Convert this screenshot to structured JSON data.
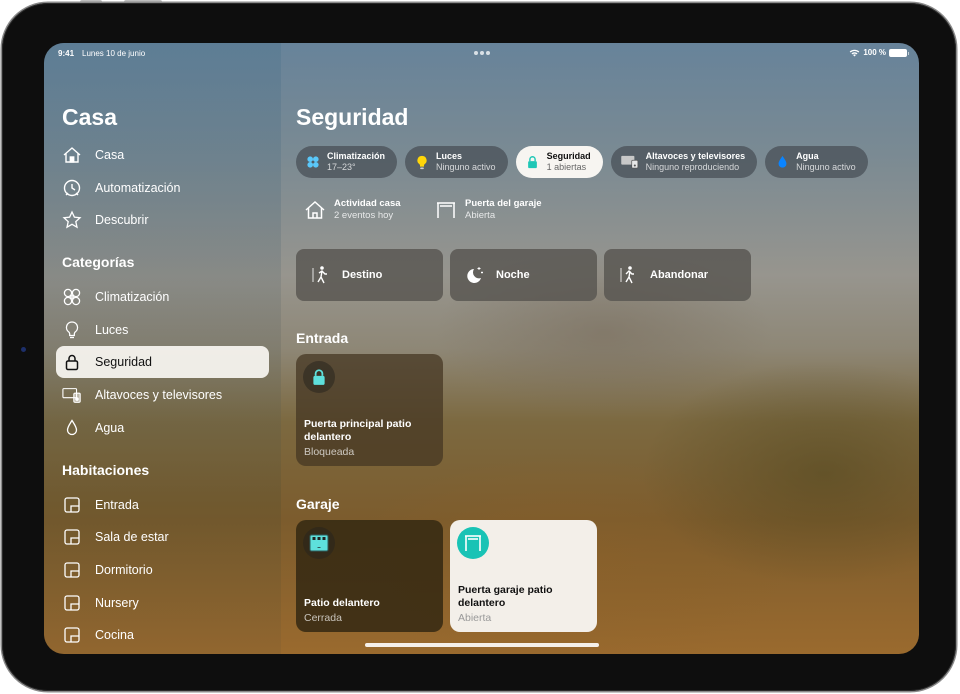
{
  "status_bar": {
    "time": "9:41",
    "date": "Lunes 10 de junio",
    "battery": "100 %",
    "wifi_icon": "wifi-icon",
    "battery_icon": "battery-icon"
  },
  "sidebar": {
    "title": "Casa",
    "nav": [
      {
        "label": "Casa",
        "icon": "house-icon"
      },
      {
        "label": "Automatización",
        "icon": "clock-icon"
      },
      {
        "label": "Descubrir",
        "icon": "star-icon"
      }
    ],
    "categories_title": "Categorías",
    "categories": [
      {
        "label": "Climatización",
        "icon": "fan-icon"
      },
      {
        "label": "Luces",
        "icon": "lightbulb-icon"
      },
      {
        "label": "Seguridad",
        "icon": "lock-icon",
        "selected": true
      },
      {
        "label": "Altavoces y televisores",
        "icon": "tv-speaker-icon"
      },
      {
        "label": "Agua",
        "icon": "drop-icon"
      }
    ],
    "rooms_title": "Habitaciones",
    "rooms": [
      {
        "label": "Entrada",
        "icon": "room-icon"
      },
      {
        "label": "Sala de estar",
        "icon": "room-icon"
      },
      {
        "label": "Dormitorio",
        "icon": "room-icon"
      },
      {
        "label": "Nursery",
        "icon": "room-icon"
      },
      {
        "label": "Cocina",
        "icon": "room-icon"
      }
    ]
  },
  "main": {
    "title": "Seguridad",
    "chips": [
      {
        "name": "Climatización",
        "sub": "17–23°",
        "icon": "fan-icon",
        "color": "#5ac8fa"
      },
      {
        "name": "Luces",
        "sub": "Ninguno activo",
        "icon": "lightbulb-icon",
        "color": "#ffd60a"
      },
      {
        "name": "Seguridad",
        "sub": "1 abiertas",
        "icon": "lock-icon",
        "color": "#1fc7b6",
        "selected": true
      },
      {
        "name": "Altavoces y televisores",
        "sub": "Ninguno reproduciendo",
        "icon": "tv-speaker-icon",
        "color": "#d0d0d0"
      },
      {
        "name": "Agua",
        "sub": "Ninguno activo",
        "icon": "drop-icon",
        "color": "#0a84ff"
      }
    ],
    "summary": [
      {
        "name": "Actividad casa",
        "sub": "2 eventos hoy",
        "icon": "house-icon"
      },
      {
        "name": "Puerta del garaje",
        "sub": "Abierta",
        "icon": "garage-door-icon"
      }
    ],
    "scenes": [
      {
        "label": "Destino",
        "icon": "person-arrive-icon"
      },
      {
        "label": "Noche",
        "icon": "moon-icon"
      },
      {
        "label": "Abandonar",
        "icon": "person-leave-icon"
      }
    ],
    "groups": [
      {
        "title": "Entrada",
        "tiles": [
          {
            "name": "Puerta principal patio delantero",
            "status": "Bloqueada",
            "icon": "lock-icon",
            "state": "locked"
          }
        ]
      },
      {
        "title": "Garaje",
        "tiles": [
          {
            "name": "Patio delantero",
            "status": "Cerrada",
            "icon": "garage-closed-icon",
            "state": "closed"
          },
          {
            "name": "Puerta garaje patio delantero",
            "status": "Abierta",
            "icon": "garage-open-icon",
            "state": "open"
          }
        ]
      }
    ]
  },
  "colors": {
    "accent_teal": "#1fc7b6",
    "selected_bg": "#f5f3ee"
  }
}
